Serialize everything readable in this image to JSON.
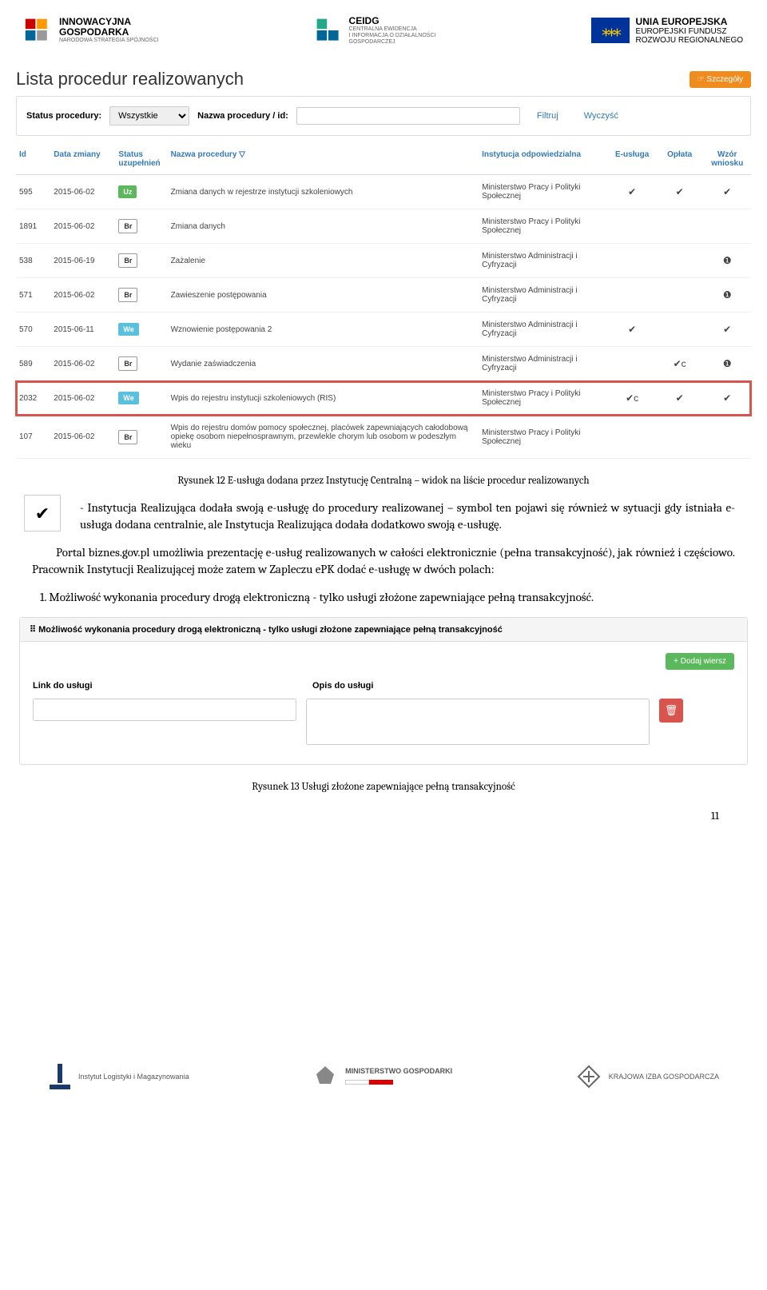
{
  "logos": {
    "left": {
      "line1": "INNOWACYJNA",
      "line2": "GOSPODARKA",
      "sub": "NARODOWA STRATEGIA SPÓJNOŚCI"
    },
    "center": {
      "line1": "CEIDG",
      "sub1": "CENTRALNA EWIDENCJA",
      "sub2": "I INFORMACJA O DZIAŁALNOŚCI",
      "sub3": "GOSPODARCZEJ"
    },
    "right": {
      "line1": "UNIA EUROPEJSKA",
      "line2": "EUROPEJSKI FUNDUSZ",
      "line3": "ROZWOJU REGIONALNEGO"
    }
  },
  "list": {
    "title": "Lista procedur realizowanych",
    "btn_details": "☞ Szczegóły",
    "filter": {
      "label_status": "Status procedury:",
      "select_val": "Wszystkie",
      "label_name": "Nazwa procedury / id:",
      "btn_filter": "Filtruj",
      "btn_clear": "Wyczyść"
    },
    "headers": {
      "id": "Id",
      "date": "Data zmiany",
      "status": "Status uzupełnień",
      "name": "Nazwa procedury ▽",
      "inst": "Instytucja odpowiedzialna",
      "eusluga": "E-usługa",
      "oplata": "Opłata",
      "wzor": "Wzór wniosku"
    },
    "rows": [
      {
        "id": "595",
        "date": "2015-06-02",
        "status": "Uz",
        "status_cls": "uz",
        "name": "Zmiana danych w rejestrze instytucji szkoleniowych",
        "inst": "Ministerstwo Pracy i Polityki Społecznej",
        "e": "✔",
        "o": "✔",
        "w": "✔",
        "hl": false
      },
      {
        "id": "1891",
        "date": "2015-06-02",
        "status": "Br",
        "status_cls": "br",
        "name": "Zmiana danych",
        "inst": "Ministerstwo Pracy i Polityki Społecznej",
        "e": "",
        "o": "",
        "w": "",
        "hl": false
      },
      {
        "id": "538",
        "date": "2015-06-19",
        "status": "Br",
        "status_cls": "br",
        "name": "Zażalenie",
        "inst": "Ministerstwo Administracji i Cyfryzacji",
        "e": "",
        "o": "",
        "w": "❶",
        "hl": false
      },
      {
        "id": "571",
        "date": "2015-06-02",
        "status": "Br",
        "status_cls": "br",
        "name": "Zawieszenie postępowania",
        "inst": "Ministerstwo Administracji i Cyfryzacji",
        "e": "",
        "o": "",
        "w": "❶",
        "hl": false
      },
      {
        "id": "570",
        "date": "2015-06-11",
        "status": "We",
        "status_cls": "we",
        "name": "Wznowienie postępowania 2",
        "inst": "Ministerstwo Administracji i Cyfryzacji",
        "e": "✔",
        "o": "",
        "w": "✔",
        "hl": false
      },
      {
        "id": "589",
        "date": "2015-06-02",
        "status": "Br",
        "status_cls": "br",
        "name": "Wydanie zaświadczenia",
        "inst": "Ministerstwo Administracji i Cyfryzacji",
        "e": "",
        "o": "✔c",
        "w": "❶",
        "hl": false
      },
      {
        "id": "2032",
        "date": "2015-06-02",
        "status": "We",
        "status_cls": "we",
        "name": "Wpis do rejestru instytucji szkoleniowych (RIS)",
        "inst": "Ministerstwo Pracy i Polityki Społecznej",
        "e": "✔c",
        "o": "✔",
        "w": "✔",
        "hl": true
      },
      {
        "id": "107",
        "date": "2015-06-02",
        "status": "Br",
        "status_cls": "br",
        "name": "Wpis do rejestru domów pomocy społecznej, placówek zapewniających całodobową opiekę osobom niepełnosprawnym, przewlekle chorym lub osobom w podeszłym wieku",
        "inst": "Ministerstwo Pracy i Polityki Społecznej",
        "e": "",
        "o": "",
        "w": "",
        "hl": false
      }
    ]
  },
  "caption1": "Rysunek 12 E-usługa dodana przez Instytucję Centralną – widok na liście procedur realizowanych",
  "check_icon": "✔",
  "para1": "- Instytucja Realizująca dodała swoją e-usługę do procedury realizowanej – symbol ten pojawi się również w sytuacji gdy istniała e-usługa dodana centralnie, ale Instytucja Realizująca dodała dodatkowo swoją e-usługę.",
  "para2": "Portal biznes.gov.pl umożliwia prezentację e-usług realizowanych w całości elektronicznie (pełna transakcyjność), jak również i częściowo. Pracownik Instytucji Realizującej może zatem w Zapleczu ePK dodać e-usługę w dwóch polach:",
  "para3": "1. Możliwość wykonania procedury drogą elektroniczną - tylko usługi złożone zapewniające pełną transakcyjność.",
  "panel2": {
    "hdr": "⠿ Możliwość wykonania procedury drogą elektroniczną - tylko usługi złożone zapewniające pełną transakcyjność",
    "btn_add": "+ Dodaj wiersz",
    "lbl_link": "Link do usługi",
    "lbl_opis": "Opis do usługi",
    "btn_del": "🗑"
  },
  "caption2": "Rysunek 13 Usługi złożone zapewniające pełną transakcyjność",
  "pagenum": "11",
  "footer": {
    "left": "Instytut Logistyki i Magazynowania",
    "center": "MINISTERSTWO GOSPODARKI",
    "right": "KRAJOWA IZBA GOSPODARCZA"
  }
}
